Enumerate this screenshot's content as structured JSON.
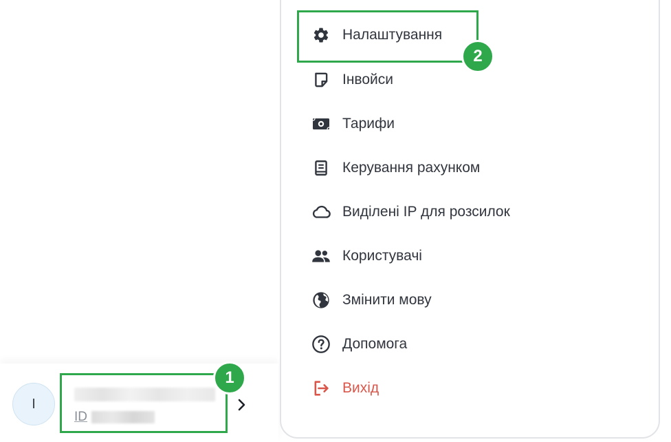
{
  "account": {
    "avatar_initial": "I",
    "id_prefix": "ID"
  },
  "annotations": {
    "badge_1": "1",
    "badge_2": "2",
    "highlight_color": "#2ea84a"
  },
  "menu": {
    "items": [
      {
        "label": "Налаштування",
        "icon": "gear-icon"
      },
      {
        "label": "Інвойси",
        "icon": "invoice-icon"
      },
      {
        "label": "Тарифи",
        "icon": "money-icon"
      },
      {
        "label": "Керування рахунком",
        "icon": "book-icon"
      },
      {
        "label": "Виділені IP для розсилок",
        "icon": "cloud-icon"
      },
      {
        "label": "Користувачі",
        "icon": "users-icon"
      },
      {
        "label": "Змінити мову",
        "icon": "globe-icon"
      },
      {
        "label": "Допомога",
        "icon": "help-icon"
      },
      {
        "label": "Вихід",
        "icon": "logout-icon",
        "color": "#d9574a"
      }
    ]
  }
}
